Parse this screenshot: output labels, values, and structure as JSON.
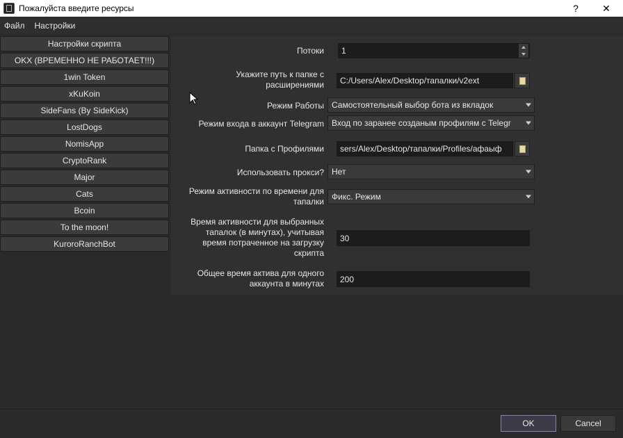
{
  "window": {
    "title": "Пожалуйста введите ресурсы",
    "help_label": "?",
    "close_label": "✕"
  },
  "menu": [
    "Файл",
    "Настройки"
  ],
  "sidebar": {
    "items": [
      "Настройки скрипта",
      "OKX (ВРЕМЕННО НЕ РАБОТАЕТ!!!)",
      "1win Token",
      "xKuKoin",
      "SideFans (By SideKick)",
      "LostDogs",
      "NomisApp",
      "CryptoRank",
      "Major",
      "Cats",
      "Bcoin",
      "To the moon!",
      "KuroroRanchBot"
    ]
  },
  "form": {
    "threads": {
      "label": "Потоки",
      "value": "1"
    },
    "extensions_path": {
      "label_1": "Укажите путь к папке с",
      "label_2": "расширениями",
      "value": "C:/Users/Alex/Desktop/тапалки/v2ext"
    },
    "work_mode": {
      "label": "Режим Работы",
      "value": "Самостоятельный выбор бота из вкладок"
    },
    "telegram_login": {
      "label": "Режим входа в аккаунт Telegram",
      "value": "Вход по заранее созданым профилям с Telegr"
    },
    "profiles_folder": {
      "label": "Папка с Профилями",
      "value": "sers/Alex/Desktop/тапалки/Profiles/афаыф"
    },
    "use_proxy": {
      "label": "Использовать прокси?",
      "value": "Нет"
    },
    "activity_mode": {
      "label_1": "Режим активности по времени для",
      "label_2": "тапалки",
      "value": "Фикс. Режим"
    },
    "activity_time": {
      "label_1": "Время активности для выбранных",
      "label_2": "тапалок (в минутах), учитывая",
      "label_3": "время потраченное на загрузку",
      "label_4": "скрипта",
      "value": "30"
    },
    "total_time": {
      "label_1": "Общее время актива для одного",
      "label_2": "аккаунта в минутах",
      "value": "200"
    }
  },
  "footer": {
    "ok_label": "OK",
    "cancel_label": "Cancel"
  }
}
